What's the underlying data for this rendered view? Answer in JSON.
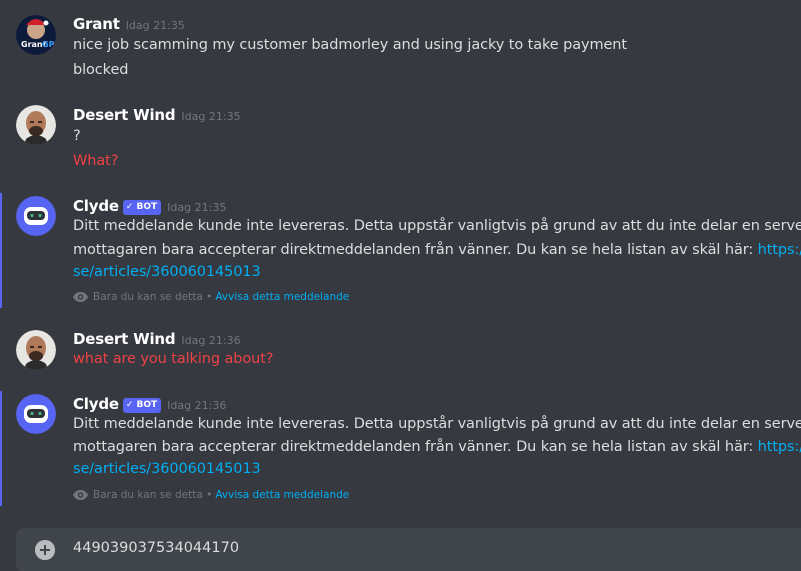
{
  "messages": [
    {
      "author": "Grant",
      "timestamp": "Idag 21:35",
      "avatar_text_top": "Grant",
      "avatar_text_accent": "GP",
      "lines": [
        "nice job scamming my customer badmorley and using jacky to take payment",
        "blocked"
      ]
    },
    {
      "author": "Desert Wind",
      "timestamp": "Idag 21:35",
      "lines": [
        "?",
        "What?"
      ]
    },
    {
      "author": "Clyde",
      "badge": "✓ BOT",
      "timestamp": "Idag 21:35",
      "line1": "Ditt meddelande kunde inte levereras. Detta uppstår vanligtvis på grund av att du inte delar en server med mot",
      "line2_text": "mottagaren bara accepterar direktmeddelanden från vänner. Du kan se hela listan av skäl här: ",
      "line2_link": "https://support",
      "line3_link": "se/articles/360060145013",
      "ephemeral_note": "Bara du kan se detta",
      "ephemeral_sep": "•",
      "dismiss": "Avvisa detta meddelande"
    },
    {
      "author": "Desert Wind",
      "timestamp": "Idag 21:36",
      "lines": [
        "what are you talking about?"
      ]
    },
    {
      "author": "Clyde",
      "badge": "✓ BOT",
      "timestamp": "Idag 21:36",
      "line1": "Ditt meddelande kunde inte levereras. Detta uppstår vanligtvis på grund av att du inte delar en server med mot",
      "line2_text": "mottagaren bara accepterar direktmeddelanden från vänner. Du kan se hela listan av skäl här: ",
      "line2_link": "https://support",
      "line3_link": "se/articles/360060145013",
      "ephemeral_note": "Bara du kan se detta",
      "ephemeral_sep": "•",
      "dismiss": "Avvisa detta meddelande"
    }
  ],
  "composer": {
    "value": "449039037534044170",
    "attach_icon": "plus-circle-icon"
  },
  "colors": {
    "background": "#36393f",
    "composer": "#40444b",
    "blurple": "#5865f2",
    "link": "#00aff4",
    "red_text": "#ed4245"
  }
}
